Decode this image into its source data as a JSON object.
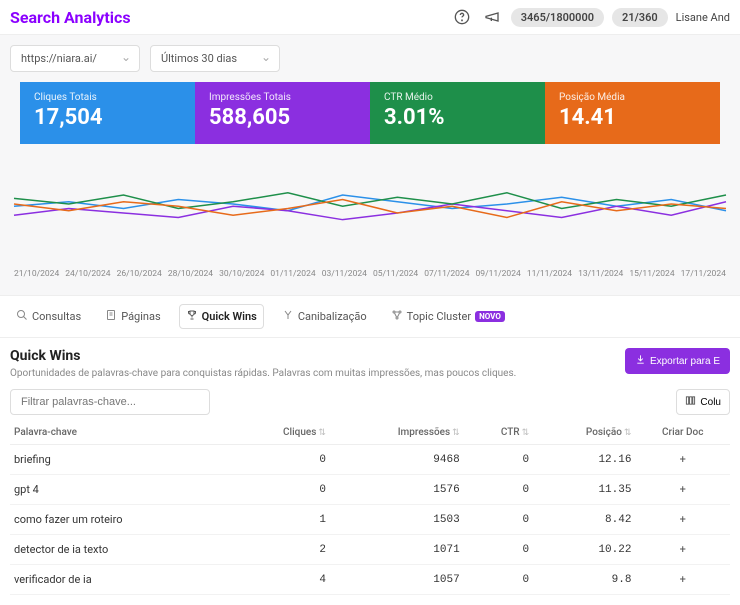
{
  "header": {
    "title": "Search Analytics",
    "counter1": "3465/1800000",
    "counter2": "21/360",
    "user": "Lisane And"
  },
  "filters": {
    "site": "https://niara.ai/",
    "period": "Últimos 30 dias"
  },
  "metrics": [
    {
      "label": "Cliques Totais",
      "value": "17,504"
    },
    {
      "label": "Impressões Totais",
      "value": "588,605"
    },
    {
      "label": "CTR Médio",
      "value": "3.01%"
    },
    {
      "label": "Posição Média",
      "value": "14.41"
    }
  ],
  "chart_data": {
    "type": "line",
    "x": [
      "21/10/2024",
      "24/10/2024",
      "26/10/2024",
      "28/10/2024",
      "30/10/2024",
      "01/11/2024",
      "03/11/2024",
      "05/11/2024",
      "07/11/2024",
      "09/11/2024",
      "11/11/2024",
      "13/11/2024",
      "15/11/2024",
      "17/11/2024"
    ],
    "series": [
      {
        "name": "Cliques Totais",
        "color": "#2b90e9",
        "values": [
          48,
          52,
          46,
          54,
          50,
          44,
          58,
          52,
          46,
          50,
          56,
          48,
          54,
          44
        ]
      },
      {
        "name": "Impressões Totais",
        "color": "#8b2fe0",
        "values": [
          40,
          46,
          42,
          38,
          48,
          44,
          36,
          42,
          50,
          44,
          38,
          48,
          40,
          52
        ]
      },
      {
        "name": "CTR Médio",
        "color": "#1e8f4a",
        "values": [
          55,
          50,
          58,
          46,
          52,
          60,
          48,
          56,
          50,
          60,
          46,
          54,
          48,
          58
        ]
      },
      {
        "name": "Posição Média",
        "color": "#e76a1a",
        "values": [
          50,
          44,
          52,
          48,
          40,
          46,
          54,
          42,
          48,
          38,
          52,
          44,
          50,
          46
        ]
      }
    ],
    "ylim": [
      0,
      100
    ]
  },
  "tabs": {
    "consultas": "Consultas",
    "paginas": "Páginas",
    "quickwins": "Quick Wins",
    "canibalizacao": "Canibalização",
    "topiccluster": "Topic Cluster",
    "badge": "NOVO"
  },
  "quickwins": {
    "title": "Quick Wins",
    "desc": "Oportunidades de palavras-chave para conquistas rápidas. Palavras com muitas impressões, mas poucos cliques.",
    "export": "Exportar para E",
    "filter_placeholder": "Filtrar palavras-chave...",
    "cols_btn": "Colu",
    "headers": {
      "keyword": "Palavra-chave",
      "clicks": "Cliques",
      "impressions": "Impressões",
      "ctr": "CTR",
      "position": "Posição",
      "create": "Criar Doc"
    },
    "rows": [
      {
        "kw": "briefing",
        "clicks": "0",
        "imp": "9468",
        "ctr": "0",
        "pos": "12.16"
      },
      {
        "kw": "gpt 4",
        "clicks": "0",
        "imp": "1576",
        "ctr": "0",
        "pos": "11.35"
      },
      {
        "kw": "como fazer um roteiro",
        "clicks": "1",
        "imp": "1503",
        "ctr": "0",
        "pos": "8.42"
      },
      {
        "kw": "detector de ia texto",
        "clicks": "2",
        "imp": "1071",
        "ctr": "0",
        "pos": "10.22"
      },
      {
        "kw": "verificador de ia",
        "clicks": "4",
        "imp": "1057",
        "ctr": "0",
        "pos": "9.8"
      }
    ]
  }
}
